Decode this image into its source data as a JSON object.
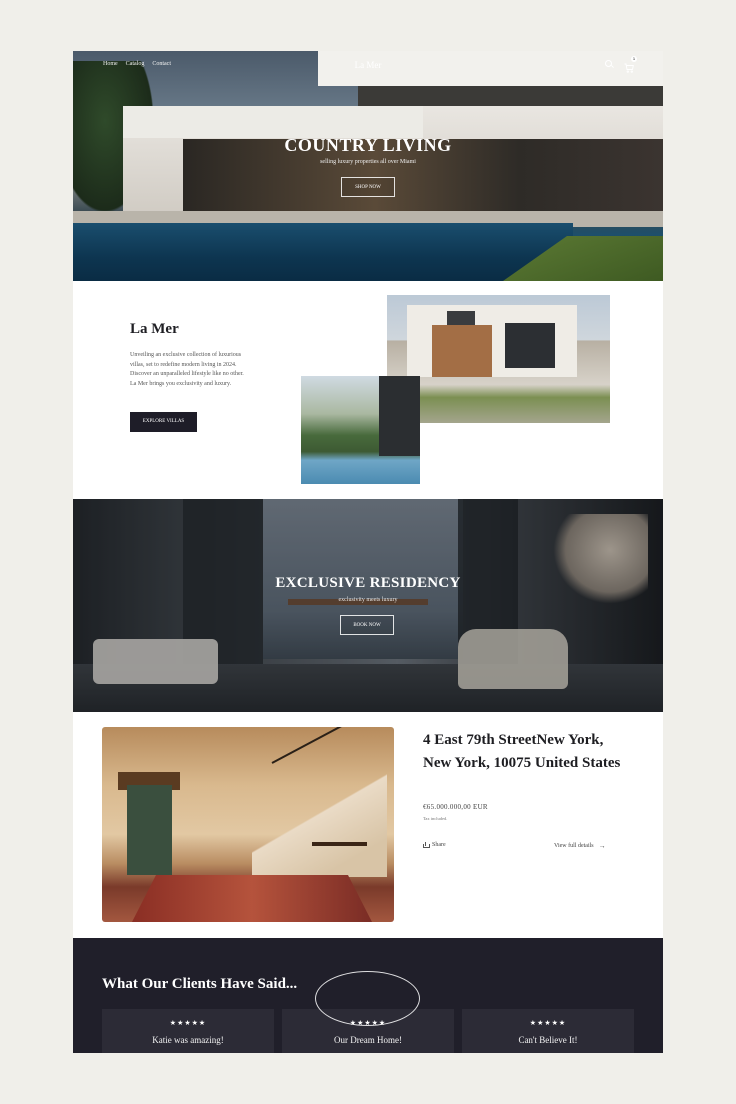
{
  "nav": {
    "links": [
      "Home",
      "Catalog",
      "Contact"
    ],
    "brand": "La Mer",
    "cart_count": "1"
  },
  "hero": {
    "title": "COUNTRY LIVING",
    "subtitle": "selling luxury properties all over Miami",
    "button": "SHOP NOW"
  },
  "intro": {
    "title": "La Mer",
    "text": "Unveiling an exclusive collection of luxurious villas, set to redefine modern living in 2024. Discover an unparalleled lifestyle like no other. La Mer brings you exclusivity and luxury.",
    "button": "EXPLORE VILLAS"
  },
  "exclusive": {
    "title": "EXCLUSIVE RESIDENCY",
    "subtitle": "exclusivity meets luxury",
    "button": "BOOK NOW"
  },
  "property": {
    "title": "4 East 79th StreetNew York, New York, 10075 United States",
    "price": "€65.000.000,00 EUR",
    "tax": "Tax included.",
    "share": "Share",
    "details": "View full details"
  },
  "testimonials": {
    "title": "What Our Clients Have Said...",
    "cards": [
      {
        "stars": "★★★★★",
        "title": "Katie was amazing!"
      },
      {
        "stars": "★★★★★",
        "title": "Our Dream Home!"
      },
      {
        "stars": "★★★★★",
        "title": "Can't Believe It!"
      }
    ]
  },
  "colors": {
    "page_bg": "#f0efea",
    "dark": "#1e1d28",
    "testimonial_bg": "#201f2a",
    "card_bg": "#2c2b36"
  }
}
